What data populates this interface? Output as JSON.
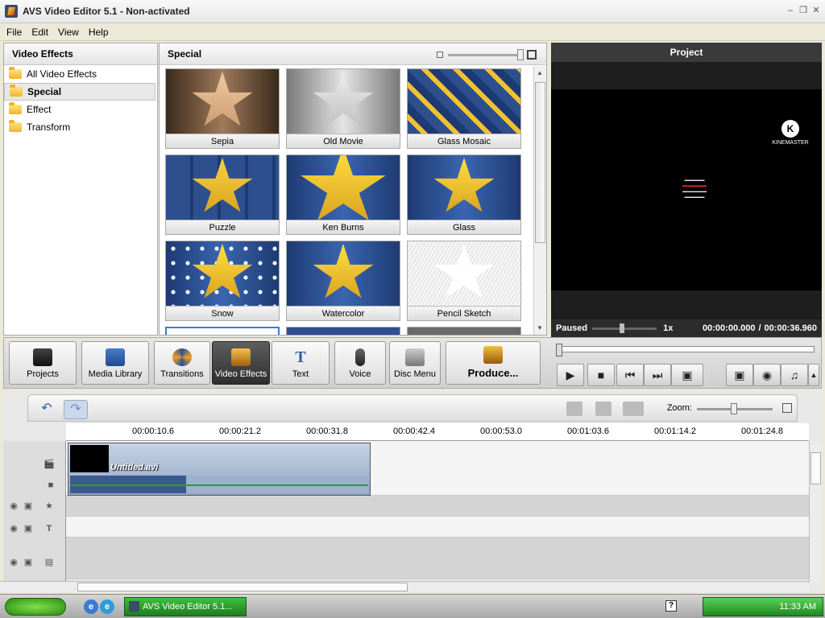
{
  "window": {
    "title": "AVS Video Editor 5.1 - Non-activated"
  },
  "menu": [
    "File",
    "Edit",
    "View",
    "Help"
  ],
  "left_panel": {
    "header": "Video Effects",
    "items": [
      {
        "label": "All Video Effects",
        "selected": false
      },
      {
        "label": "Special",
        "selected": true
      },
      {
        "label": "Effect",
        "selected": false
      },
      {
        "label": "Transform",
        "selected": false
      }
    ]
  },
  "center_panel": {
    "header": "Special",
    "effects": [
      {
        "label": "Sepia",
        "icon": "sepia-star"
      },
      {
        "label": "Old Movie",
        "icon": "old-movie-star"
      },
      {
        "label": "Glass Mosaic",
        "icon": "glass-mosaic-star"
      },
      {
        "label": "Puzzle",
        "icon": "puzzle-star"
      },
      {
        "label": "Ken Burns",
        "icon": "ken-burns-star"
      },
      {
        "label": "Glass",
        "icon": "glass-star"
      },
      {
        "label": "Snow",
        "icon": "snow-star"
      },
      {
        "label": "Watercolor",
        "icon": "watercolor-star"
      },
      {
        "label": "Pencil Sketch",
        "icon": "pencil-sketch-star"
      }
    ]
  },
  "preview": {
    "header": "Project",
    "logo_text": "KINEMASTER",
    "status": "Paused",
    "speed": "1x",
    "time_current": "00:00:00.000",
    "time_separator": "/",
    "time_total": "00:00:36.960"
  },
  "toolbar": {
    "buttons": [
      {
        "label": "Projects",
        "icon": "clapper-icon",
        "active": false
      },
      {
        "label": "Media Library",
        "icon": "film-icon",
        "active": false
      },
      {
        "label": "Transitions",
        "icon": "transitions-icon",
        "active": false
      },
      {
        "label": "Video Effects",
        "icon": "video-effects-icon",
        "active": true
      },
      {
        "label": "Text",
        "icon": "text-icon",
        "active": false
      },
      {
        "label": "Voice",
        "icon": "microphone-icon",
        "active": false
      },
      {
        "label": "Disc Menu",
        "icon": "disc-menu-icon",
        "active": false
      },
      {
        "label": "Produce...",
        "icon": "produce-icon",
        "active": false
      }
    ]
  },
  "timeline": {
    "zoom_label": "Zoom:",
    "ruler": [
      "00:00:10.6",
      "00:00:21.2",
      "00:00:31.8",
      "00:00:42.4",
      "00:00:53.0",
      "00:01:03.6",
      "00:01:14.2",
      "00:01:24.8"
    ],
    "clip_title": "Untitled.avi"
  },
  "taskbar": {
    "task_label": "AVS Video Editor 5.1...",
    "clock": "11:33 AM"
  },
  "colors": {
    "active_tool": "#3a3a3a",
    "clip": "#8fa6c6",
    "taskbar_green": "#1e8a1e"
  }
}
